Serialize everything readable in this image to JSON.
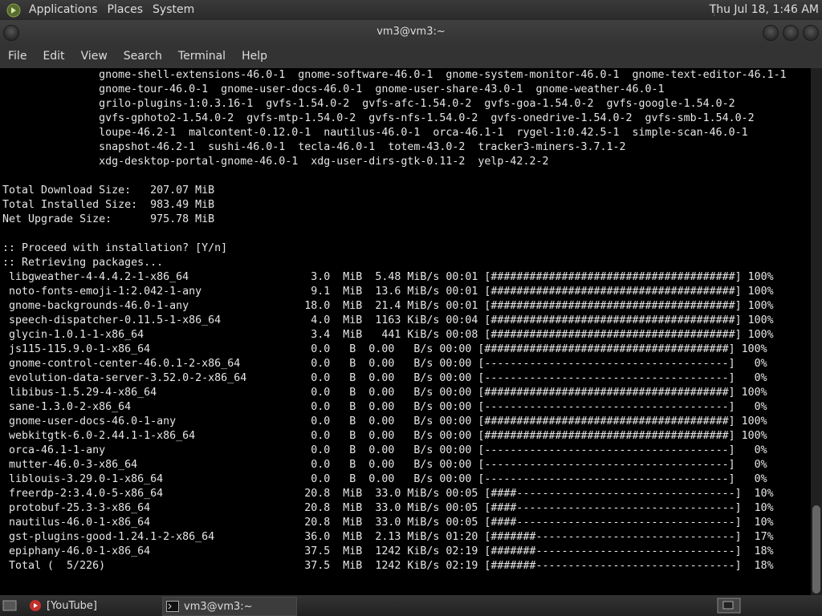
{
  "top_panel": {
    "menus": [
      "Applications",
      "Places",
      "System"
    ],
    "clock": "Thu Jul 18,  1:46 AM"
  },
  "window": {
    "title": "vm3@vm3:~"
  },
  "menu_bar": [
    "File",
    "Edit",
    "View",
    "Search",
    "Terminal",
    "Help"
  ],
  "terminal_lines": [
    "               gnome-shell-extensions-46.0-1  gnome-software-46.0-1  gnome-system-monitor-46.0-1  gnome-text-editor-46.1-1",
    "               gnome-tour-46.0-1  gnome-user-docs-46.0-1  gnome-user-share-43.0-1  gnome-weather-46.0-1",
    "               grilo-plugins-1:0.3.16-1  gvfs-1.54.0-2  gvfs-afc-1.54.0-2  gvfs-goa-1.54.0-2  gvfs-google-1.54.0-2",
    "               gvfs-gphoto2-1.54.0-2  gvfs-mtp-1.54.0-2  gvfs-nfs-1.54.0-2  gvfs-onedrive-1.54.0-2  gvfs-smb-1.54.0-2",
    "               loupe-46.2-1  malcontent-0.12.0-1  nautilus-46.0-1  orca-46.1-1  rygel-1:0.42.5-1  simple-scan-46.0-1",
    "               snapshot-46.2-1  sushi-46.0-1  tecla-46.0-1  totem-43.0-2  tracker3-miners-3.7.1-2",
    "               xdg-desktop-portal-gnome-46.0-1  xdg-user-dirs-gtk-0.11-2  yelp-42.2-2",
    "",
    "Total Download Size:   207.07 MiB",
    "Total Installed Size:  983.49 MiB",
    "Net Upgrade Size:      975.78 MiB",
    "",
    ":: Proceed with installation? [Y/n]",
    ":: Retrieving packages...",
    " libgweather-4-4.4.2-1-x86_64                   3.0  MiB  5.48 MiB/s 00:01 [######################################] 100%",
    " noto-fonts-emoji-1:2.042-1-any                 9.1  MiB  13.6 MiB/s 00:01 [######################################] 100%",
    " gnome-backgrounds-46.0-1-any                  18.0  MiB  21.4 MiB/s 00:01 [######################################] 100%",
    " speech-dispatcher-0.11.5-1-x86_64              4.0  MiB  1163 KiB/s 00:04 [######################################] 100%",
    " glycin-1.0.1-1-x86_64                          3.4  MiB   441 KiB/s 00:08 [######################################] 100%",
    " js115-115.9.0-1-x86_64                         0.0   B  0.00   B/s 00:00 [######################################] 100%",
    " gnome-control-center-46.0.1-2-x86_64           0.0   B  0.00   B/s 00:00 [--------------------------------------]   0%",
    " evolution-data-server-3.52.0-2-x86_64          0.0   B  0.00   B/s 00:00 [--------------------------------------]   0%",
    " libibus-1.5.29-4-x86_64                        0.0   B  0.00   B/s 00:00 [######################################] 100%",
    " sane-1.3.0-2-x86_64                            0.0   B  0.00   B/s 00:00 [--------------------------------------]   0%",
    " gnome-user-docs-46.0-1-any                     0.0   B  0.00   B/s 00:00 [######################################] 100%",
    " webkitgtk-6.0-2.44.1-1-x86_64                  0.0   B  0.00   B/s 00:00 [######################################] 100%",
    " orca-46.1-1-any                                0.0   B  0.00   B/s 00:00 [--------------------------------------]   0%",
    " mutter-46.0-3-x86_64                           0.0   B  0.00   B/s 00:00 [--------------------------------------]   0%",
    " liblouis-3.29.0-1-x86_64                       0.0   B  0.00   B/s 00:00 [--------------------------------------]   0%",
    " freerdp-2:3.4.0-5-x86_64                      20.8  MiB  33.0 MiB/s 00:05 [####----------------------------------]  10%",
    " protobuf-25.3-3-x86_64                        20.8  MiB  33.0 MiB/s 00:05 [####----------------------------------]  10%",
    " nautilus-46.0-1-x86_64                        20.8  MiB  33.0 MiB/s 00:05 [####----------------------------------]  10%",
    " gst-plugins-good-1.24.1-2-x86_64              36.0  MiB  2.13 MiB/s 01:20 [#######-------------------------------]  17%",
    " epiphany-46.0-1-x86_64                        37.5  MiB  1242 KiB/s 02:19 [#######-------------------------------]  18%",
    " Total (  5/226)                               37.5  MiB  1242 KiB/s 02:19 [#######-------------------------------]  18%"
  ],
  "taskbar": {
    "tasks": [
      {
        "label": "[YouTube]",
        "icon": "youtube-icon"
      },
      {
        "label": "vm3@vm3:~",
        "icon": "terminal-icon"
      }
    ]
  },
  "colors": {
    "panel": "#2e2e2e",
    "terminal_bg": "#000000",
    "terminal_fg": "#e6e6e6"
  }
}
